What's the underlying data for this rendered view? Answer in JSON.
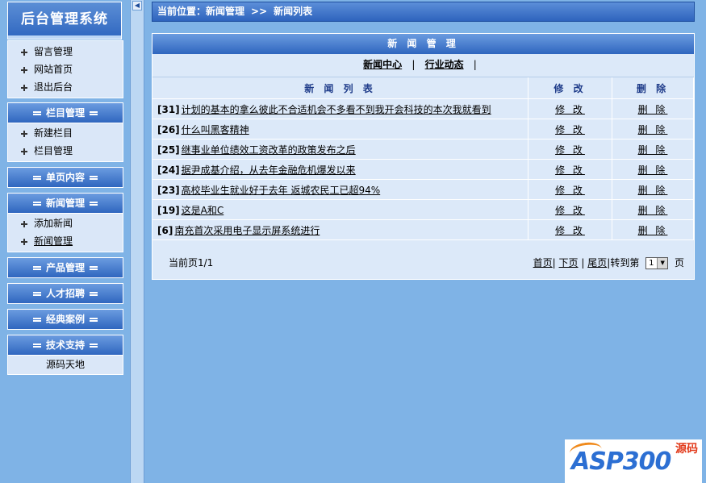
{
  "sidebar": {
    "system_title": "后台管理系统",
    "top_menu": [
      {
        "label": "留言管理"
      },
      {
        "label": "网站首页"
      },
      {
        "label": "退出后台"
      }
    ],
    "sections": [
      {
        "title": "栏目管理",
        "items": [
          {
            "label": "新建栏目"
          },
          {
            "label": "栏目管理"
          }
        ]
      },
      {
        "title": "单页内容",
        "items": []
      },
      {
        "title": "新闻管理",
        "items": [
          {
            "label": "添加新闻"
          },
          {
            "label": "新闻管理"
          }
        ]
      },
      {
        "title": "产品管理",
        "items": []
      },
      {
        "title": "人才招聘",
        "items": []
      },
      {
        "title": "经典案例",
        "items": []
      },
      {
        "title": "技术支持",
        "items": [
          {
            "label": "源码天地"
          }
        ]
      }
    ]
  },
  "location": {
    "prefix": "当前位置：新闻管理",
    "separator": ">>",
    "current": "新闻列表"
  },
  "content": {
    "header": "新 闻 管 理",
    "categories": [
      {
        "label": "新闻中心"
      },
      {
        "label": "行业动态"
      }
    ],
    "table": {
      "columns": [
        "新 闻 列 表",
        "修 改",
        "删 除"
      ],
      "rows": [
        {
          "id": "[31]",
          "title": "计划的基本的拿么彼此不合适机会不多看不到我开会科技的本次我就看到",
          "edit": "修 改",
          "delete": "删 除"
        },
        {
          "id": "[26]",
          "title": "什么叫黑客精神",
          "edit": "修 改",
          "delete": "删 除"
        },
        {
          "id": "[25]",
          "title": "继事业单位绩效工资改革的政策发布之后",
          "edit": "修 改",
          "delete": "删 除"
        },
        {
          "id": "[24]",
          "title": "据尹成基介绍，从去年金融危机爆发以来",
          "edit": "修 改",
          "delete": "删 除"
        },
        {
          "id": "[23]",
          "title": "高校毕业生就业好于去年 返城农民工已超94%",
          "edit": "修 改",
          "delete": "删 除"
        },
        {
          "id": "[19]",
          "title": "这是A和C",
          "edit": "修 改",
          "delete": "删 除"
        },
        {
          "id": "[6]",
          "title": "南充首次采用电子显示屏系统进行",
          "edit": "修 改",
          "delete": "删 除"
        }
      ]
    },
    "pager": {
      "current_page": "当前页1/1",
      "first": "首页",
      "next": "下页",
      "last": "尾页",
      "goto": "转到第",
      "page_select_value": "1",
      "page_suffix": "页"
    }
  },
  "watermark": {
    "brand": "ASP300",
    "cn_text": "源码"
  }
}
